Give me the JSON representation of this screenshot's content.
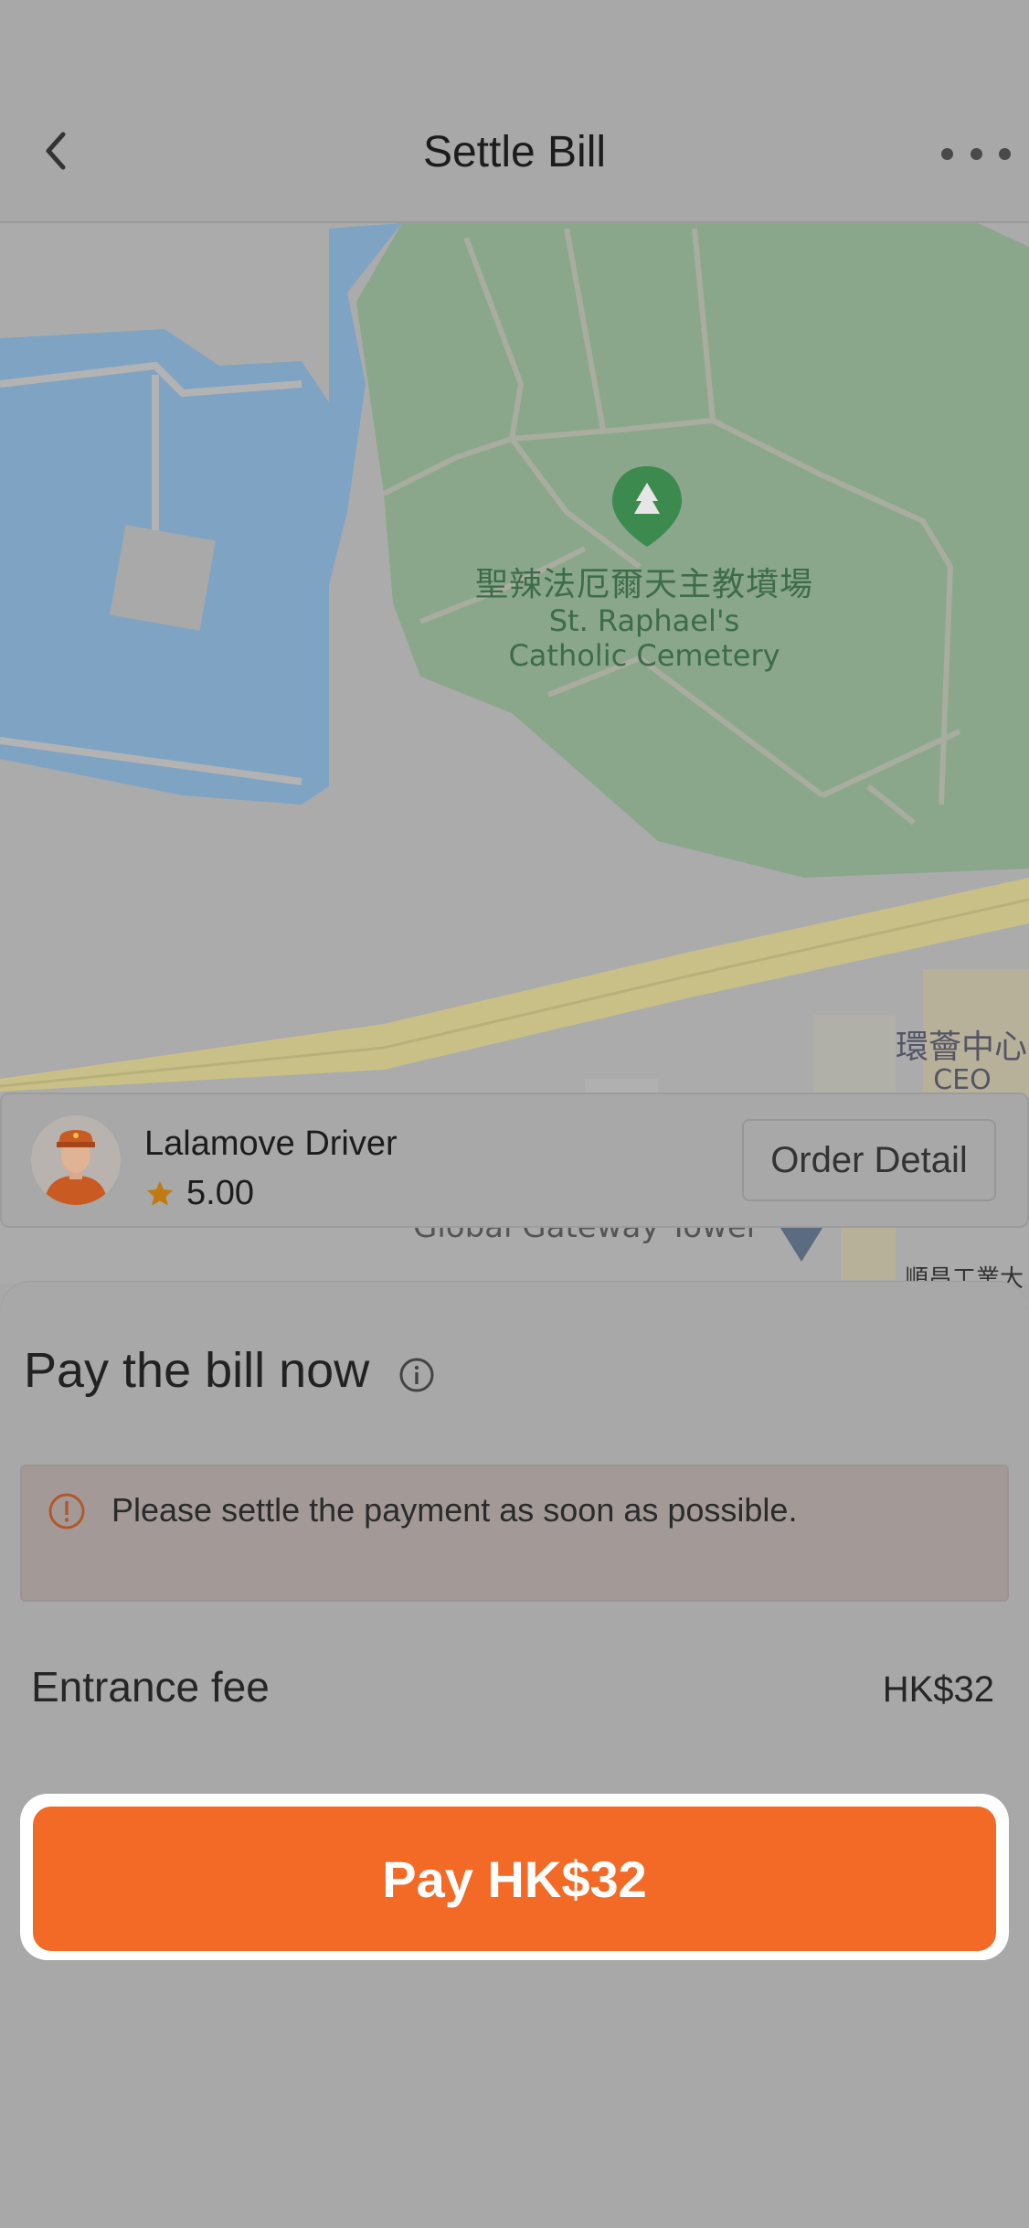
{
  "header": {
    "title": "Settle Bill"
  },
  "map": {
    "poi_name_cn": "聖辣法厄爾天主教墳場",
    "poi_name_en_line1": "St. Raphael's",
    "poi_name_en_line2": "Catholic Cemetery",
    "building_cn": "環薈中心",
    "building_en": "CEO Tower",
    "tower_label": "Global Gateway Tower",
    "bottom_cn": "順昌工業大廈"
  },
  "driver": {
    "name": "Lalamove Driver",
    "rating": "5.00",
    "order_detail_label": "Order Detail"
  },
  "sheet": {
    "heading": "Pay the bill now",
    "alert_text": "Please settle the payment as soon as possible.",
    "fee_label": "Entrance fee",
    "fee_value": "HK$32",
    "pay_label": "Pay HK$32"
  },
  "colors": {
    "accent": "#f26a25",
    "star": "#c07a10",
    "alert_icon": "#b0582c",
    "map_water": "#7fa3c3",
    "map_park": "#8aa78b",
    "map_road": "#c9c088"
  }
}
